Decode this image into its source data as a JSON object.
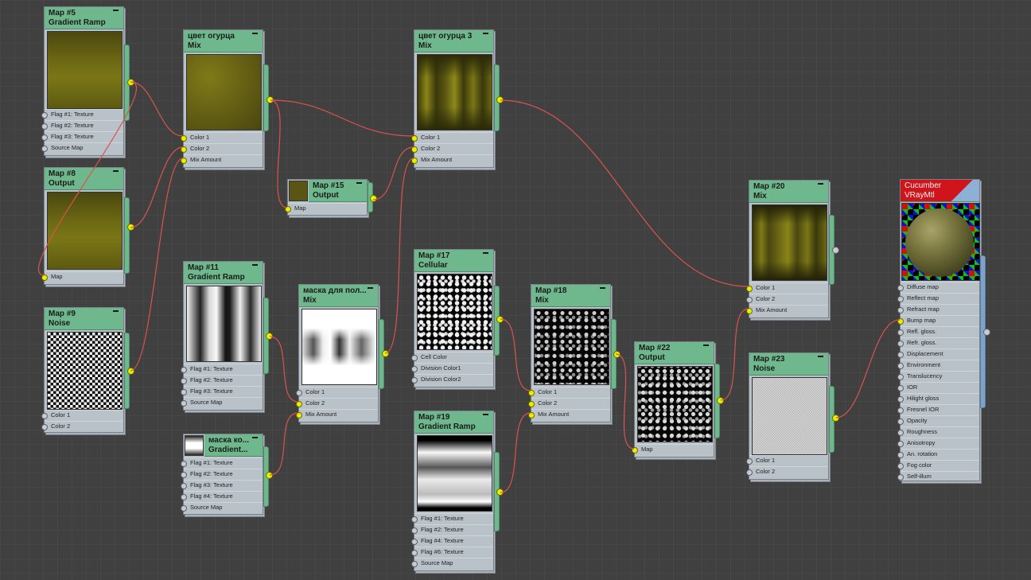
{
  "nodes": {
    "map5": {
      "title": "Map #5",
      "type": "Gradient Ramp",
      "sockets": [
        "Flag #1: Texture",
        "Flag #2: Texture",
        "Flag #3: Texture",
        "Source Map"
      ]
    },
    "map8": {
      "title": "Map #8",
      "type": "Output",
      "sockets": [
        "Map"
      ]
    },
    "map9": {
      "title": "Map #9",
      "type": "Noise",
      "sockets": [
        "Color 1",
        "Color 2"
      ]
    },
    "mix1": {
      "title": "цвет огурца",
      "type": "Mix",
      "sockets": [
        "Color 1",
        "Color 2",
        "Mix Amount"
      ]
    },
    "map15": {
      "title": "Map #15",
      "type": "Output",
      "sockets": [
        "Map"
      ]
    },
    "map11": {
      "title": "Map #11",
      "type": "Gradient Ramp",
      "sockets": [
        "Flag #1: Texture",
        "Flag #2: Texture",
        "Flag #3: Texture",
        "Source Map"
      ]
    },
    "maskGrad": {
      "title": "маска ко...",
      "type": "Gradient...",
      "sockets": [
        "Flag #1: Texture",
        "Flag #2: Texture",
        "Flag #3: Texture",
        "Flag #4: Texture",
        "Source Map"
      ]
    },
    "maskMix": {
      "title": "маска для пол...",
      "type": "Mix",
      "sockets": [
        "Color 1",
        "Color 2",
        "Mix Amount"
      ]
    },
    "mix3": {
      "title": "цвет огурца 3",
      "type": "Mix",
      "sockets": [
        "Color 1",
        "Color 2",
        "Mix Amount"
      ]
    },
    "map17": {
      "title": "Map #17",
      "type": "Cellular",
      "sockets": [
        "Cell Color",
        "Division Color1",
        "Division Color2"
      ]
    },
    "map19": {
      "title": "Map #19",
      "type": "Gradient Ramp",
      "sockets": [
        "Flag #1: Texture",
        "Flag #2: Texture",
        "Flag #4: Texture",
        "Flag #6: Texture",
        "Source Map"
      ]
    },
    "map18": {
      "title": "Map #18",
      "type": "Mix",
      "sockets": [
        "Color 1",
        "Color 2",
        "Mix Amount"
      ]
    },
    "map22": {
      "title": "Map #22",
      "type": "Output",
      "sockets": [
        "Map"
      ]
    },
    "map20": {
      "title": "Map #20",
      "type": "Mix",
      "sockets": [
        "Color 1",
        "Color 2",
        "Mix Amount"
      ]
    },
    "map23": {
      "title": "Map #23",
      "type": "Noise",
      "sockets": [
        "Color 1",
        "Color 2"
      ]
    },
    "material": {
      "title": "Cucumber",
      "type": "VRayMtl",
      "sockets": [
        "Diffuse map",
        "Reflect map",
        "Refract map",
        "Bump map",
        "Refl. gloss.",
        "Refr. gloss.",
        "Displacement",
        "Environment",
        "Translucency",
        "IOR",
        "Hilight gloss",
        "Fresnel IOR",
        "Opacity",
        "Roughness",
        "Anisotropy",
        "An. rotation",
        "Fog color",
        "Self-illum"
      ]
    }
  },
  "colors": {
    "header": "#6fb88e",
    "node_body": "#b9c1c9",
    "wire": "#d9534f",
    "socket_connected": "#e8f000",
    "material_header": "#d0141c"
  }
}
